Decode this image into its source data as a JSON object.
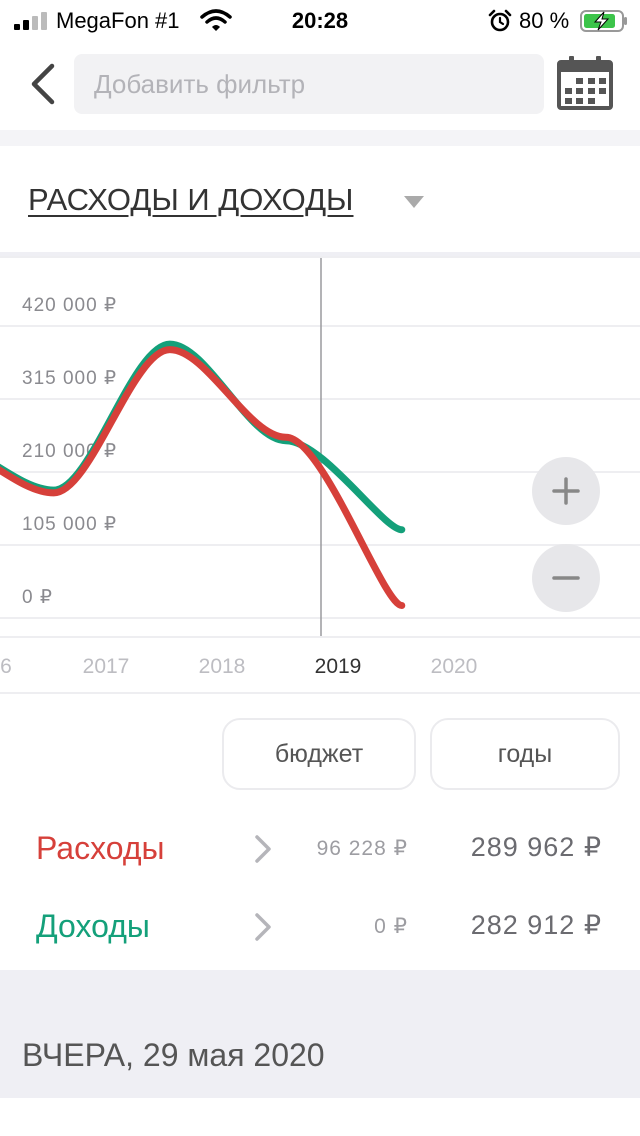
{
  "status_bar": {
    "carrier": "MegaFon #1",
    "time": "20:28",
    "battery_percent": "80 %",
    "icons": [
      "signal-icon",
      "wifi-icon",
      "alarm-icon",
      "battery-charging-icon"
    ]
  },
  "nav": {
    "back_icon": "chevron-left-icon",
    "filter_placeholder": "Добавить фильтр",
    "calendar_icon": "calendar-icon"
  },
  "report": {
    "title": "РАСХОДЫ И ДОХОДЫ",
    "dropdown_icon": "caret-down-icon"
  },
  "chart_data": {
    "type": "line",
    "y_ticks": [
      "420 000 ₽",
      "315 000 ₽",
      "210 000 ₽",
      "105 000 ₽",
      "0 ₽"
    ],
    "ylim": [
      0,
      420000
    ],
    "x_ticks": [
      "6",
      "2017",
      "2018",
      "2019",
      "2020"
    ],
    "selected_x": "2019",
    "grid": true,
    "series": [
      {
        "name": "Доходы",
        "color": "#14a07a",
        "x": [
          2015.55,
          2016.55,
          2017.55,
          2018.55,
          2019.55
        ],
        "y": [
          255000,
          184000,
          394000,
          255000,
          127000
        ]
      },
      {
        "name": "Расходы",
        "color": "#d6403a",
        "x": [
          2015.55,
          2016.55,
          2017.55,
          2018.55,
          2019.55
        ],
        "y": [
          252000,
          180000,
          386000,
          260000,
          18000
        ]
      }
    ]
  },
  "zoom": {
    "in_icon": "plus-icon",
    "out_icon": "minus-icon"
  },
  "controls": {
    "budget_label": "бюджет",
    "years_label": "годы"
  },
  "summary": {
    "expenses": {
      "label": "Расходы",
      "period": "96 228 ₽",
      "total": "289 962 ₽",
      "color": "#d6403a"
    },
    "income": {
      "label": "Доходы",
      "period": "0 ₽",
      "total": "282 912 ₽",
      "color": "#14a07a"
    }
  },
  "feed": {
    "date_header": "ВЧЕРА, 29 мая 2020"
  }
}
